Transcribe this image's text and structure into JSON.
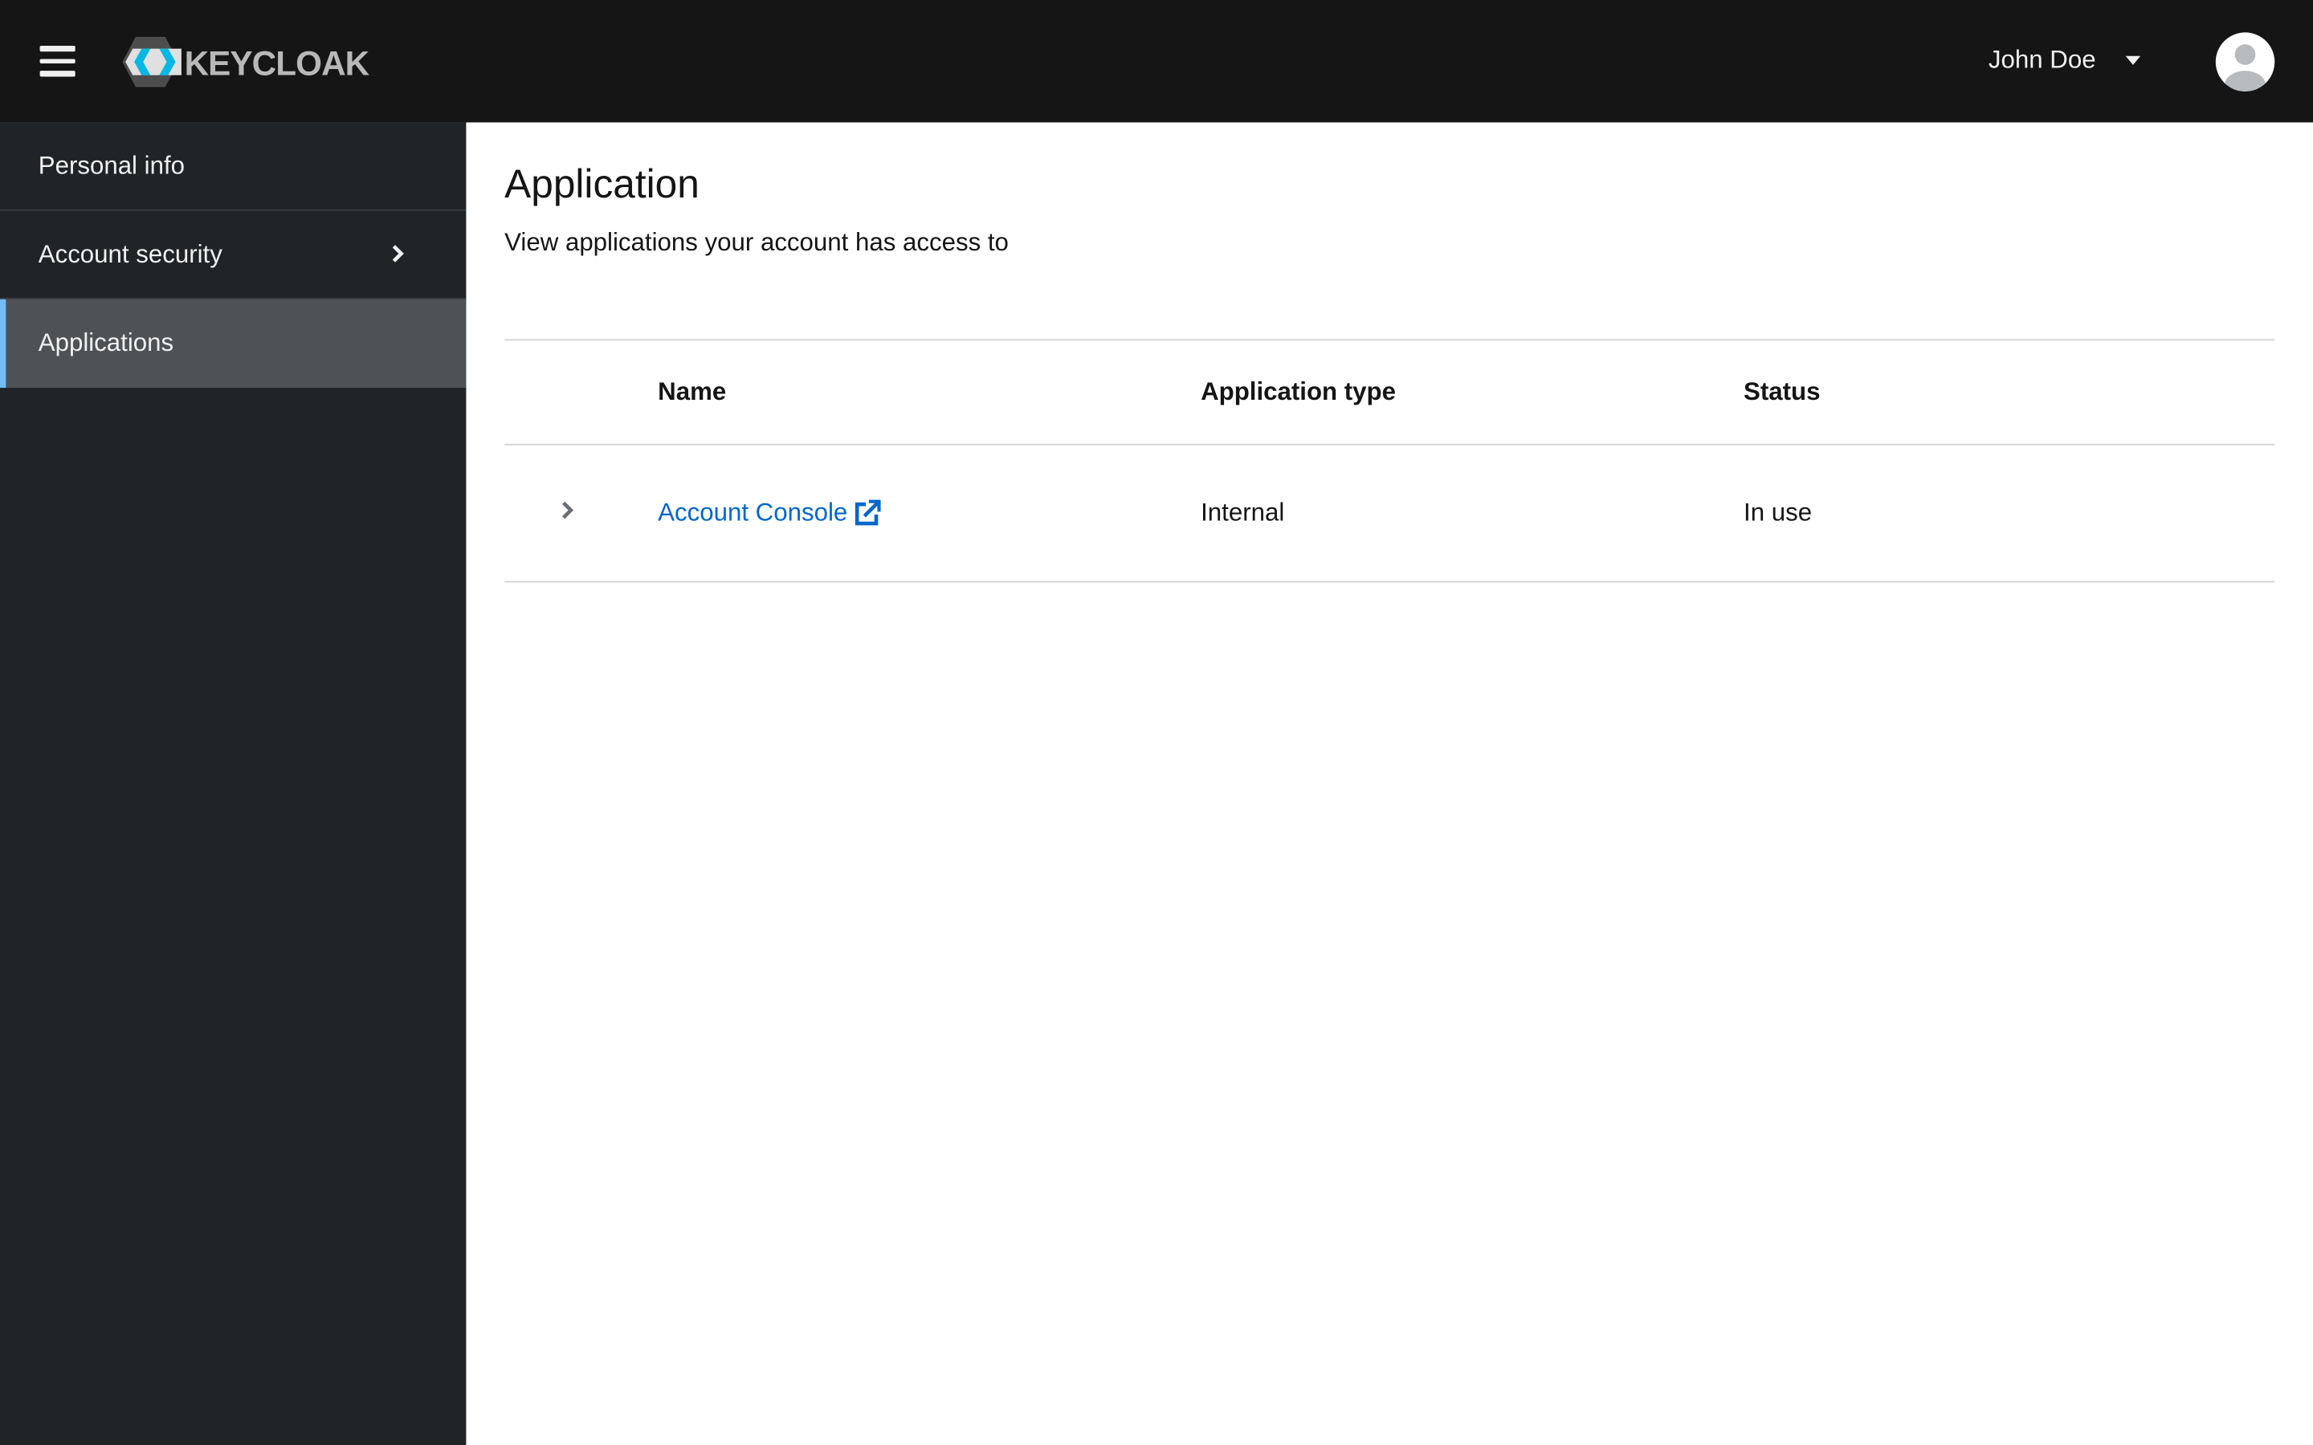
{
  "header": {
    "brand": "KEYCLOAK",
    "user_name": "John Doe"
  },
  "sidebar": {
    "items": [
      {
        "label": "Personal info"
      },
      {
        "label": "Account security"
      },
      {
        "label": "Applications"
      }
    ]
  },
  "page": {
    "title": "Application",
    "description": "View applications your account has access to"
  },
  "table": {
    "columns": [
      "Name",
      "Application type",
      "Status"
    ],
    "rows": [
      {
        "name": "Account Console",
        "type": "Internal",
        "status": "In use"
      }
    ]
  },
  "colors": {
    "accent": "#0066cc",
    "header_bg": "#151515",
    "sidebar_bg": "#212427",
    "active_bar": "#73bcf7"
  }
}
